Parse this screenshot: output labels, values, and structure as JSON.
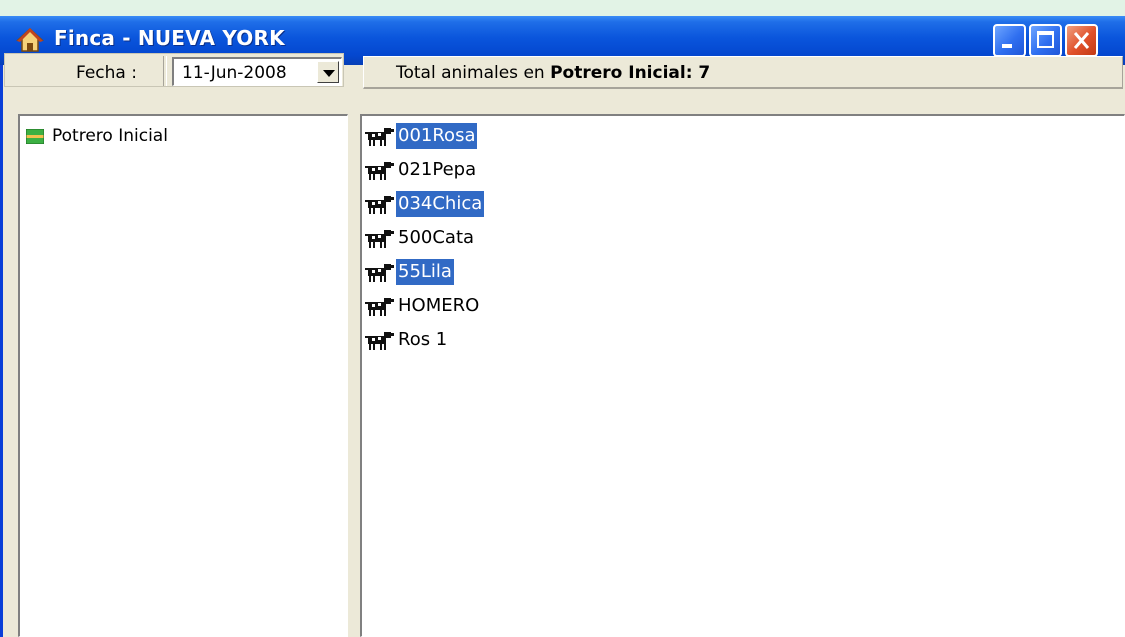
{
  "window": {
    "title": "Finca - NUEVA YORK",
    "title_color": "#0a55dc"
  },
  "toolbar": {
    "fecha_label": "Fecha :",
    "fecha_value": "11-Jun-2008"
  },
  "header": {
    "prefix": "Total animales en ",
    "bold": "Potrero Inicial: 7"
  },
  "tree": {
    "items": [
      {
        "label": "Potrero Inicial",
        "icon": "pasture-icon"
      }
    ]
  },
  "animals": [
    {
      "name": "001Rosa",
      "selected": true
    },
    {
      "name": "021Pepa",
      "selected": false
    },
    {
      "name": "034Chica",
      "selected": true
    },
    {
      "name": "500Cata",
      "selected": false
    },
    {
      "name": "55Lila",
      "selected": true
    },
    {
      "name": "HOMERO",
      "selected": false
    },
    {
      "name": "Ros 1",
      "selected": false
    }
  ],
  "colors": {
    "selection": "#316ac5",
    "face": "#ece9d8",
    "desktop": "#e2f3e6"
  }
}
